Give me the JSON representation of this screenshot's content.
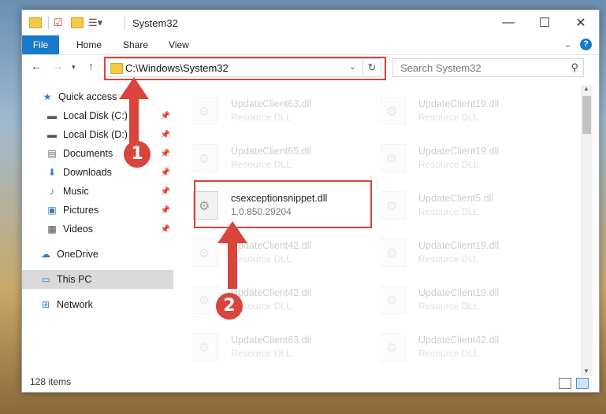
{
  "window": {
    "title": "System32",
    "minimize_icon": "minimize-icon",
    "maximize_icon": "maximize-icon",
    "close_icon": "close-icon"
  },
  "ribbon": {
    "tabs": [
      {
        "label": "File"
      },
      {
        "label": "Home"
      },
      {
        "label": "Share"
      },
      {
        "label": "View"
      }
    ]
  },
  "address": {
    "path": "C:\\Windows\\System32",
    "search_placeholder": "Search System32"
  },
  "nav": {
    "items": [
      {
        "label": "Quick access"
      },
      {
        "label": "Local Disk (C:)"
      },
      {
        "label": "Local Disk (D:)"
      },
      {
        "label": "Documents"
      },
      {
        "label": "Downloads"
      },
      {
        "label": "Music"
      },
      {
        "label": "Pictures"
      },
      {
        "label": "Videos"
      },
      {
        "label": "OneDrive"
      },
      {
        "label": "This PC"
      },
      {
        "label": "Network"
      }
    ]
  },
  "files": {
    "left": [
      {
        "name": "UpdateClient63.dll",
        "desc": "Resource DLL"
      },
      {
        "name": "UpdateClient65.dll",
        "desc": "Resource DLL"
      },
      {
        "name": "csexceptionsnippet.dll",
        "desc": "1.0.850.29204"
      },
      {
        "name": "UpdateClient42.dll",
        "desc": "Resource DLL"
      },
      {
        "name": "UpdateClient42.dll",
        "desc": "Resource DLL"
      },
      {
        "name": "UpdateClient63.dll",
        "desc": "Resource DLL"
      }
    ],
    "right": [
      {
        "name": "UpdateClient19.dll",
        "desc": "Resource DLL"
      },
      {
        "name": "UpdateClient19.dll",
        "desc": "Resource DLL"
      },
      {
        "name": "UpdateClient5.dll",
        "desc": "Resource DLL"
      },
      {
        "name": "UpdateClient19.dll",
        "desc": "Resource DLL"
      },
      {
        "name": "UpdateClient19.dll",
        "desc": "Resource DLL"
      },
      {
        "name": "UpdateClient42.dll",
        "desc": "Resource DLL"
      }
    ]
  },
  "status": {
    "item_count": "128 items"
  },
  "annotations": {
    "step1": "1",
    "step2": "2",
    "color": "#d9443b"
  }
}
